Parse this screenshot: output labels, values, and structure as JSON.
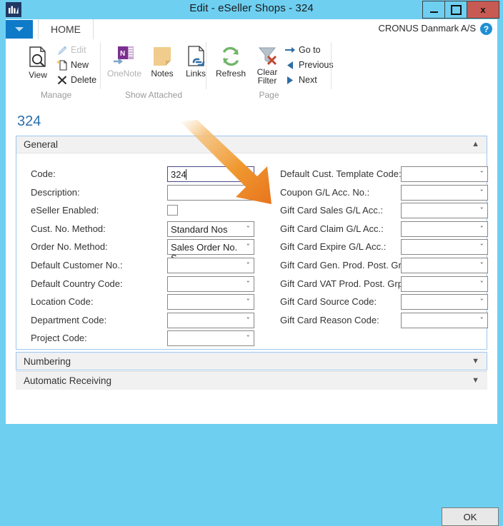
{
  "window": {
    "title": "Edit - eSeller Shops - 324",
    "logo_icon": "nav-logo-icon",
    "buttons": {
      "minimize": "minimize-icon",
      "maximize": "maximize-icon",
      "close": "x"
    }
  },
  "ribbon": {
    "quick_access_caret": "chevron-down-icon",
    "tab_label": "HOME",
    "company": "CRONUS Danmark A/S",
    "help_label": "?",
    "groups": [
      {
        "name": "Manage",
        "label": "Manage",
        "big_buttons": [
          {
            "label": "View",
            "icon": "page-search-icon",
            "disabled": false
          }
        ],
        "small_buttons": [
          {
            "label": "Edit",
            "icon": "pencil-icon",
            "disabled": true
          },
          {
            "label": "New",
            "icon": "new-page-icon",
            "disabled": false
          },
          {
            "label": "Delete",
            "icon": "x-delete-icon",
            "disabled": false
          }
        ]
      },
      {
        "name": "Show Attached",
        "label": "Show Attached",
        "big_buttons": [
          {
            "label": "OneNote",
            "icon": "onenote-icon",
            "disabled": true
          },
          {
            "label": "Notes",
            "icon": "sticky-note-icon",
            "disabled": false
          },
          {
            "label": "Links",
            "icon": "link-page-icon",
            "disabled": false
          }
        ],
        "small_buttons": []
      },
      {
        "name": "Page",
        "label": "Page",
        "big_buttons": [
          {
            "label": "Refresh",
            "icon": "refresh-icon",
            "disabled": false
          },
          {
            "label": "Clear Filter",
            "icon": "clear-filter-icon",
            "disabled": false
          }
        ],
        "small_buttons": [
          {
            "label": "Go to",
            "icon": "arrow-right-icon",
            "disabled": false
          },
          {
            "label": "Previous",
            "icon": "triangle-left-icon",
            "disabled": false
          },
          {
            "label": "Next",
            "icon": "triangle-right-icon",
            "disabled": false
          }
        ]
      }
    ]
  },
  "page": {
    "title": "324",
    "sections": [
      {
        "key": "general",
        "label": "General",
        "expanded": true,
        "chevron": "chevron-up-icon"
      },
      {
        "key": "numbering",
        "label": "Numbering",
        "expanded": false,
        "chevron": "chevron-down-icon"
      },
      {
        "key": "automatic_receiving",
        "label": "Automatic Receiving",
        "expanded": false,
        "chevron": "chevron-down-icon"
      }
    ],
    "left_fields": [
      {
        "label": "Code:",
        "type": "text",
        "value": "324",
        "focused": true
      },
      {
        "label": "Description:",
        "type": "text",
        "value": "",
        "focused": false
      },
      {
        "label": "eSeller Enabled:",
        "type": "checkbox",
        "checked": false
      },
      {
        "label": "Cust. No. Method:",
        "type": "dropdown",
        "value": "Standard Nos"
      },
      {
        "label": "Order No. Method:",
        "type": "dropdown",
        "value": "Sales Order No. S..."
      },
      {
        "label": "Default Customer No.:",
        "type": "dropdown",
        "value": ""
      },
      {
        "label": "Default Country Code:",
        "type": "dropdown",
        "value": ""
      },
      {
        "label": "Location Code:",
        "type": "dropdown",
        "value": ""
      },
      {
        "label": "Department Code:",
        "type": "dropdown",
        "value": ""
      },
      {
        "label": "Project Code:",
        "type": "dropdown",
        "value": ""
      }
    ],
    "right_fields": [
      {
        "label": "Default Cust. Template Code:",
        "type": "dropdown",
        "value": ""
      },
      {
        "label": "Coupon G/L Acc. No.:",
        "type": "dropdown",
        "value": ""
      },
      {
        "label": "Gift Card Sales G/L Acc.:",
        "type": "dropdown",
        "value": ""
      },
      {
        "label": "Gift Card Claim G/L Acc.:",
        "type": "dropdown",
        "value": ""
      },
      {
        "label": "Gift Card Expire G/L Acc.:",
        "type": "dropdown",
        "value": ""
      },
      {
        "label": "Gift Card Gen. Prod. Post. Grp:",
        "type": "dropdown",
        "value": ""
      },
      {
        "label": "Gift Card VAT Prod. Post. Grp:",
        "type": "dropdown",
        "value": ""
      },
      {
        "label": "Gift Card Source Code:",
        "type": "dropdown",
        "value": ""
      },
      {
        "label": "Gift Card Reason Code:",
        "type": "dropdown",
        "value": ""
      }
    ],
    "ok_button": "OK"
  },
  "annotation": {
    "arrow_icon": "orange-arrow-annotation",
    "color": "#ED8B2A",
    "color_light": "#F7C27A"
  },
  "colors": {
    "window_chrome": "#6ecff1",
    "title_accent": "#2a6fad",
    "panel_border": "#9fc7ee",
    "close_button": "#c85a54",
    "qat": "#0f7ac7"
  }
}
